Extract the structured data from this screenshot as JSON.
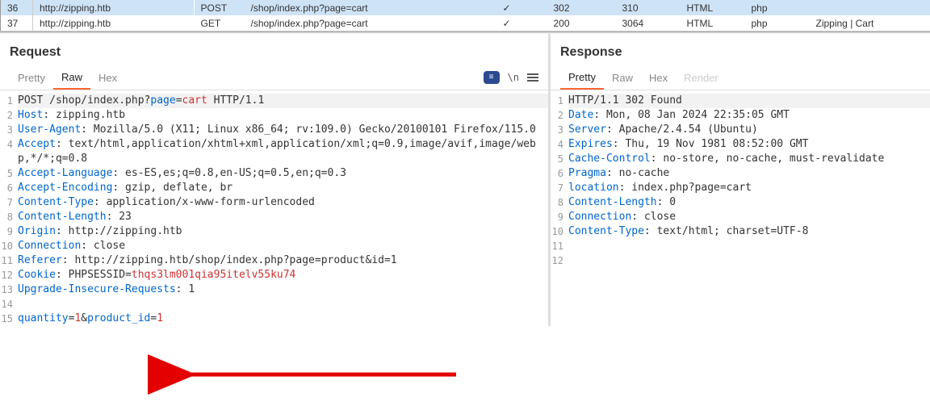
{
  "history": {
    "rows": [
      {
        "num": "36",
        "host": "http://zipping.htb",
        "method": "POST",
        "url": "/shop/index.php?page=cart",
        "edited": "✓",
        "status": "302",
        "len": "310",
        "mime": "HTML",
        "ext": "php",
        "title": ""
      },
      {
        "num": "37",
        "host": "http://zipping.htb",
        "method": "GET",
        "url": "/shop/index.php?page=cart",
        "edited": "✓",
        "status": "200",
        "len": "3064",
        "mime": "HTML",
        "ext": "php",
        "title": "Zipping | Cart"
      }
    ]
  },
  "request": {
    "title": "Request",
    "tabs": {
      "pretty": "Pretty",
      "raw": "Raw",
      "hex": "Hex",
      "ln": "\\n"
    },
    "lines": {
      "l1_method": "POST ",
      "l1_path": "/shop/index.php?",
      "l1_pkey": "page",
      "l1_eq": "=",
      "l1_pval": "cart",
      "l1_proto": " HTTP/1.1",
      "l2_k": "Host",
      "l2_v": ": zipping.htb",
      "l3_k": "User-Agent",
      "l3_v": ": Mozilla/5.0 (X11; Linux x86_64; rv:109.0) Gecko/20100101 Firefox/115.0",
      "l4_k": "Accept",
      "l4_v": ": text/html,application/xhtml+xml,application/xml;q=0.9,image/avif,image/webp,*/*;q=0.8",
      "l5_k": "Accept-Language",
      "l5_v": ": es-ES,es;q=0.8,en-US;q=0.5,en;q=0.3",
      "l6_k": "Accept-Encoding",
      "l6_v": ": gzip, deflate, br",
      "l7_k": "Content-Type",
      "l7_v": ": application/x-www-form-urlencoded",
      "l8_k": "Content-Length",
      "l8_v": ": 23",
      "l9_k": "Origin",
      "l9_v": ": http://zipping.htb",
      "l10_k": "Connection",
      "l10_v": ": close",
      "l11_k": "Referer",
      "l11_v": ": http://zipping.htb/shop/index.php?page=product&id=1",
      "l12_k": "Cookie",
      "l12_v1": ": PHPSESSID=",
      "l12_v2": "thqs3lm001qia95itelv55ku74",
      "l13_k": "Upgrade-Insecure-Requests",
      "l13_v": ": 1",
      "l15_k1": "quantity",
      "l15_v1": "1",
      "l15_amp": "&",
      "l15_k2": "product_id",
      "l15_v2": "1"
    }
  },
  "response": {
    "title": "Response",
    "tabs": {
      "pretty": "Pretty",
      "raw": "Raw",
      "hex": "Hex",
      "render": "Render"
    },
    "lines": {
      "l1": "HTTP/1.1 302 Found",
      "l2_k": "Date",
      "l2_v": ": Mon, 08 Jan 2024 22:35:05 GMT",
      "l3_k": "Server",
      "l3_v": ": Apache/2.4.54 (Ubuntu)",
      "l4_k": "Expires",
      "l4_v": ": Thu, 19 Nov 1981 08:52:00 GMT",
      "l5_k": "Cache-Control",
      "l5_v": ": no-store, no-cache, must-revalidate",
      "l6_k": "Pragma",
      "l6_v": ": no-cache",
      "l7_k": "location",
      "l7_v": ": index.php?page=cart",
      "l8_k": "Content-Length",
      "l8_v": ": 0",
      "l9_k": "Connection",
      "l9_v": ": close",
      "l10_k": "Content-Type",
      "l10_v": ": text/html; charset=UTF-8"
    }
  }
}
